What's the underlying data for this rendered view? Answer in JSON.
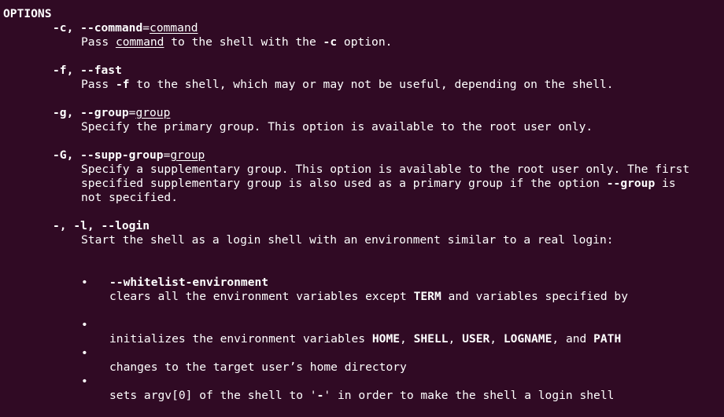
{
  "section_heading": "OPTIONS",
  "options": {
    "command": {
      "flag_short": "-c,",
      "flag_long": "--command",
      "eq": "=",
      "arg": "command",
      "desc_pre": "Pass ",
      "desc_arg": "command",
      "desc_mid": " to the shell with the ",
      "desc_flag": "-c",
      "desc_post": " option."
    },
    "fast": {
      "flags": "-f, --fast",
      "desc_pre": "Pass ",
      "desc_flag": "-f",
      "desc_post": " to the shell, which may or may not be useful, depending on the shell."
    },
    "group": {
      "flags": "-g, --group",
      "eq": "=",
      "arg": "group",
      "desc": "Specify the primary group. This option is available to the root user only."
    },
    "supp_group": {
      "flags": "-G, --supp-group",
      "eq": "=",
      "arg": "group",
      "desc_line1": "Specify a supplementary group. This option is available to the root user only. The first",
      "desc_line2_pre": "specified supplementary group is also used as a primary group if the option ",
      "desc_line2_flag": "--group",
      "desc_line2_post": " is",
      "desc_line3": "not specified."
    },
    "login": {
      "flags": "-, -l, --login",
      "desc": "Start the shell as a login shell with an environment similar to a real login:",
      "bullet_glyph": "•",
      "bullets": {
        "b1_pre": "clears all the environment variables except ",
        "b1_term": "TERM",
        "b1_post": " and variables specified by",
        "b1_line2": "--whitelist-environment",
        "b2_pre": "initializes the environment variables ",
        "b2_home": "HOME",
        "b2_sep1": ", ",
        "b2_shell": "SHELL",
        "b2_sep2": ", ",
        "b2_user": "USER",
        "b2_sep3": ", ",
        "b2_logname": "LOGNAME",
        "b2_and": ", and ",
        "b2_path": "PATH",
        "b3": "changes to the target user’s home directory",
        "b4_pre": "sets argv[0] of the shell to '",
        "b4_dash": "-",
        "b4_post": "' in order to make the shell a login shell"
      }
    }
  },
  "colors": {
    "background": "#300a24",
    "text": "#ffffff"
  }
}
